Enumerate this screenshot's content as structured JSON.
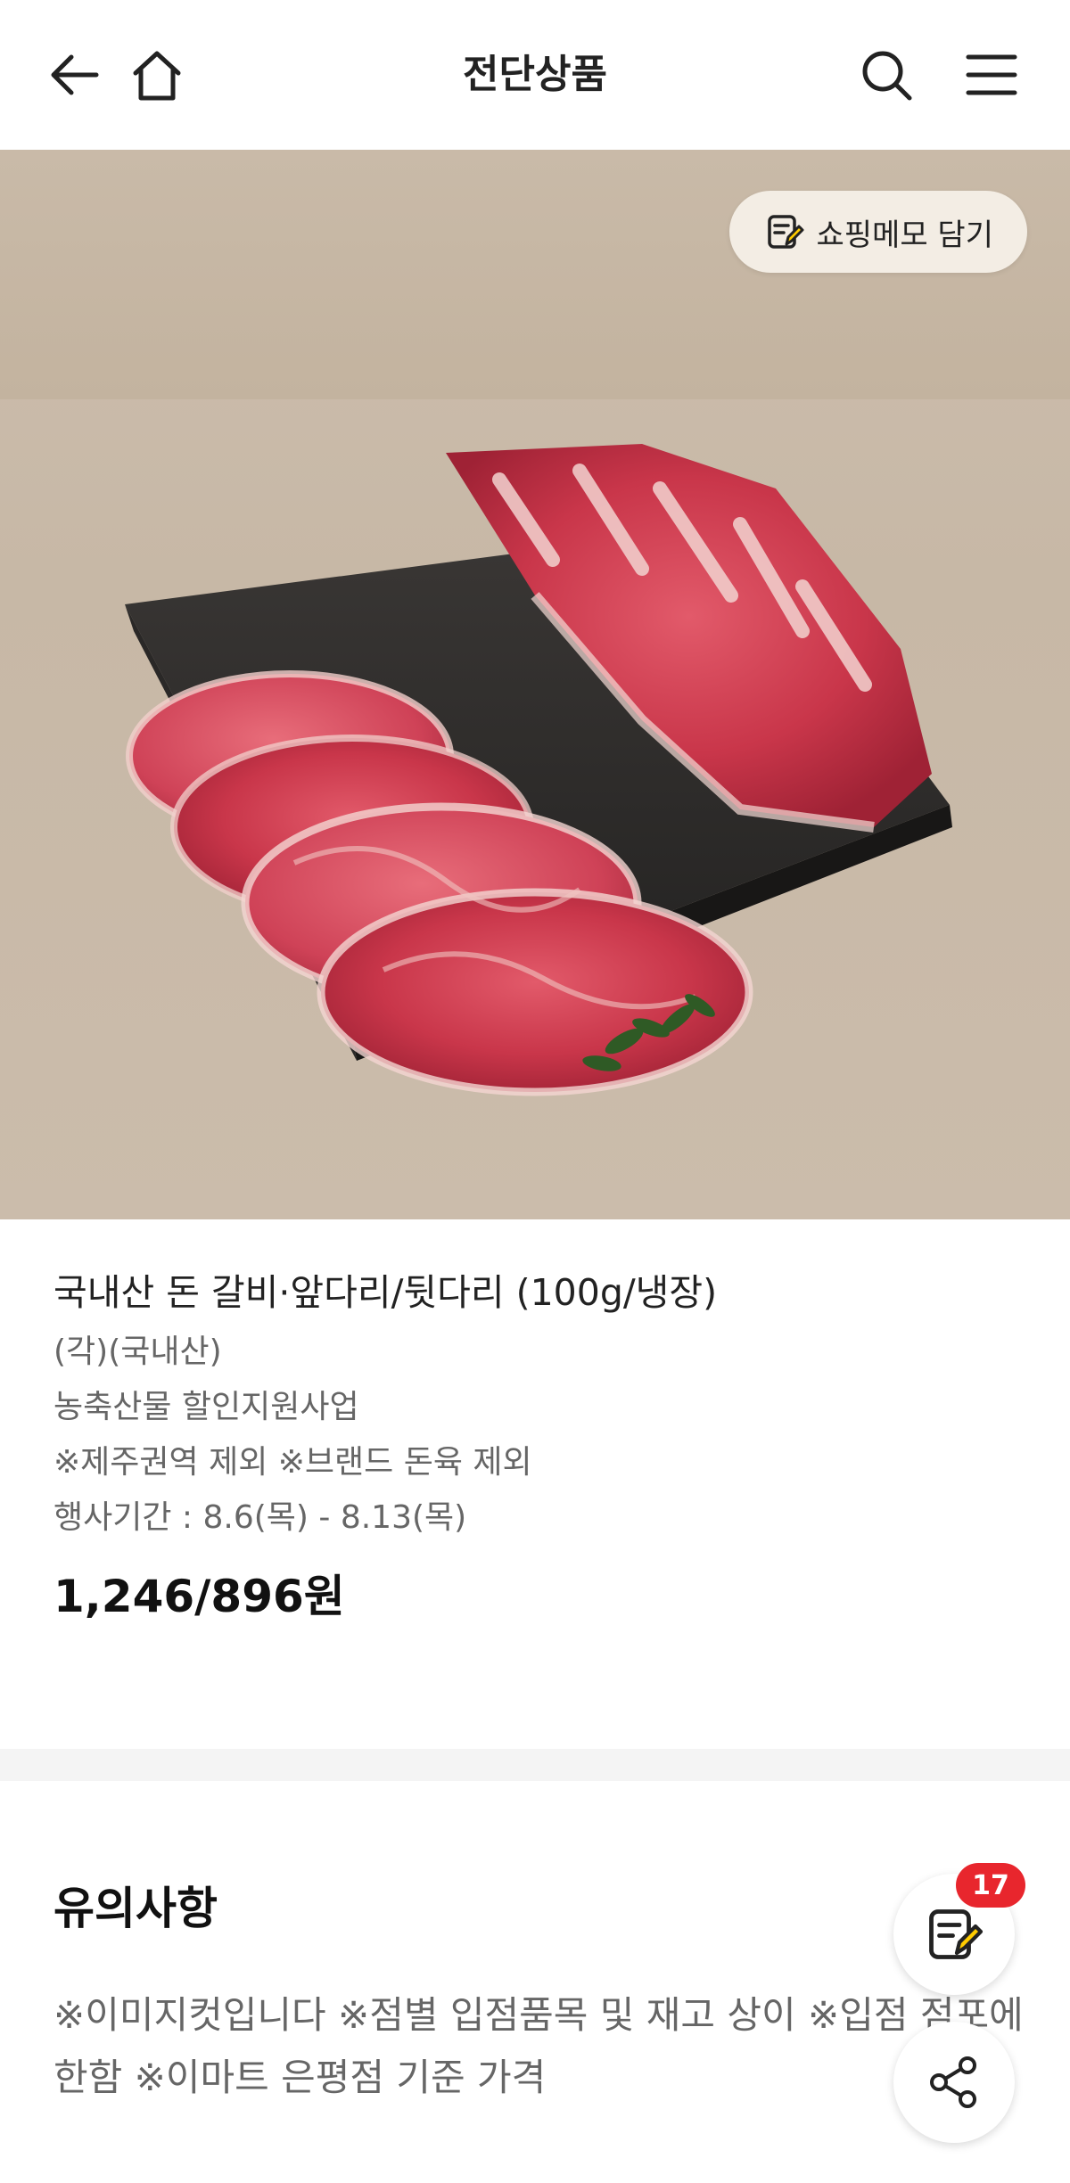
{
  "header": {
    "title": "전단상품",
    "back_icon": "arrow-left-icon",
    "home_icon": "home-icon",
    "search_icon": "search-icon",
    "menu_icon": "hamburger-menu-icon"
  },
  "hero": {
    "memo_button_label": "쇼핑메모 담기",
    "memo_icon": "memo-pencil-icon",
    "image_alt": "pork ribs and legs on dark slate board"
  },
  "product": {
    "name": "국내산 돈 갈비·앞다리/뒷다리 (100g/냉장)",
    "lines": [
      "(각)(국내산)",
      "농축산물 할인지원사업",
      "※제주권역 제외 ※브랜드 돈육 제외",
      "행사기간 : 8.6(목) - 8.13(목)"
    ],
    "price": "1,246/896원"
  },
  "notice": {
    "title": "유의사항",
    "text": "※이미지컷입니다 ※점별 입점품목 및 재고 상이 ※입점 점포에 한함 ※이마트 은평점 기준 가격"
  },
  "fab": {
    "memo_count": "17",
    "memo_icon": "memo-pencil-icon",
    "share_icon": "share-icon"
  },
  "colors": {
    "badge": "#e8262d",
    "memo_accent": "#ffcc00"
  }
}
